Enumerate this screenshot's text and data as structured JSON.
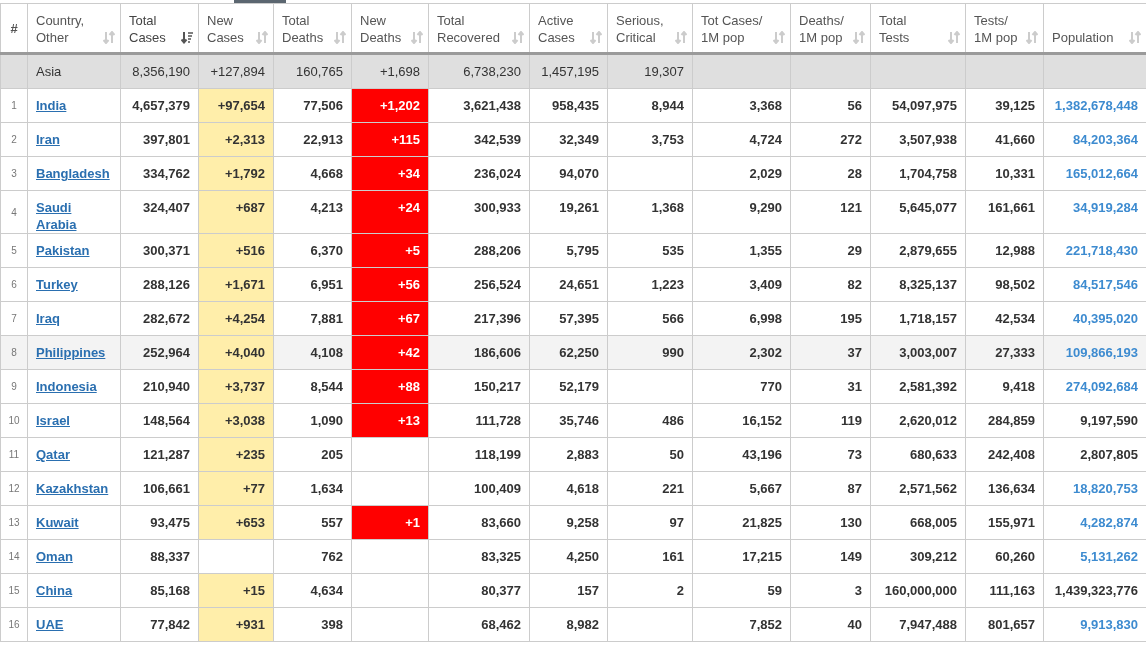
{
  "table": {
    "columns": [
      {
        "label": "#"
      },
      {
        "label": "Country,\nOther",
        "sorted": false
      },
      {
        "label": "Total\nCases",
        "sorted": true
      },
      {
        "label": "New\nCases",
        "sorted": false
      },
      {
        "label": "Total\nDeaths",
        "sorted": false
      },
      {
        "label": "New\nDeaths",
        "sorted": false
      },
      {
        "label": "Total\nRecovered",
        "sorted": false
      },
      {
        "label": "Active\nCases",
        "sorted": false
      },
      {
        "label": "Serious,\nCritical",
        "sorted": false
      },
      {
        "label": "Tot Cases/\n1M pop",
        "sorted": false
      },
      {
        "label": "Deaths/\n1M pop",
        "sorted": false
      },
      {
        "label": "Total\nTests",
        "sorted": false
      },
      {
        "label": "Tests/\n1M pop",
        "sorted": false
      },
      {
        "label": "Population",
        "sorted": false
      }
    ],
    "total_row": {
      "country": "Asia",
      "total_cases": "8,356,190",
      "new_cases": "+127,894",
      "total_deaths": "160,765",
      "new_deaths": "+1,698",
      "total_recovered": "6,738,230",
      "active_cases": "1,457,195",
      "serious_critical": "19,307"
    },
    "rows": [
      {
        "rank": "1",
        "country": "India",
        "total_cases": "4,657,379",
        "new_cases": "+97,654",
        "total_deaths": "77,506",
        "new_deaths": "+1,202",
        "total_recovered": "3,621,438",
        "active_cases": "958,435",
        "serious_critical": "8,944",
        "tot_cases_per_1m": "3,368",
        "deaths_per_1m": "56",
        "total_tests": "54,097,975",
        "tests_per_1m": "39,125",
        "population": "1,382,678,448",
        "population_link": true,
        "selected": false
      },
      {
        "rank": "2",
        "country": "Iran",
        "total_cases": "397,801",
        "new_cases": "+2,313",
        "total_deaths": "22,913",
        "new_deaths": "+115",
        "total_recovered": "342,539",
        "active_cases": "32,349",
        "serious_critical": "3,753",
        "tot_cases_per_1m": "4,724",
        "deaths_per_1m": "272",
        "total_tests": "3,507,938",
        "tests_per_1m": "41,660",
        "population": "84,203,364",
        "population_link": true,
        "selected": false
      },
      {
        "rank": "3",
        "country": "Bangladesh",
        "total_cases": "334,762",
        "new_cases": "+1,792",
        "total_deaths": "4,668",
        "new_deaths": "+34",
        "total_recovered": "236,024",
        "active_cases": "94,070",
        "tot_cases_per_1m": "2,029",
        "deaths_per_1m": "28",
        "total_tests": "1,704,758",
        "tests_per_1m": "10,331",
        "population": "165,012,664",
        "population_link": true,
        "selected": false
      },
      {
        "rank": "4",
        "country": "Saudi Arabia",
        "total_cases": "324,407",
        "new_cases": "+687",
        "total_deaths": "4,213",
        "new_deaths": "+24",
        "total_recovered": "300,933",
        "active_cases": "19,261",
        "serious_critical": "1,368",
        "tot_cases_per_1m": "9,290",
        "deaths_per_1m": "121",
        "total_tests": "5,645,077",
        "tests_per_1m": "161,661",
        "population": "34,919,284",
        "population_link": true,
        "selected": false
      },
      {
        "rank": "5",
        "country": "Pakistan",
        "total_cases": "300,371",
        "new_cases": "+516",
        "total_deaths": "6,370",
        "new_deaths": "+5",
        "total_recovered": "288,206",
        "active_cases": "5,795",
        "serious_critical": "535",
        "tot_cases_per_1m": "1,355",
        "deaths_per_1m": "29",
        "total_tests": "2,879,655",
        "tests_per_1m": "12,988",
        "population": "221,718,430",
        "population_link": true,
        "selected": false
      },
      {
        "rank": "6",
        "country": "Turkey",
        "total_cases": "288,126",
        "new_cases": "+1,671",
        "total_deaths": "6,951",
        "new_deaths": "+56",
        "total_recovered": "256,524",
        "active_cases": "24,651",
        "serious_critical": "1,223",
        "tot_cases_per_1m": "3,409",
        "deaths_per_1m": "82",
        "total_tests": "8,325,137",
        "tests_per_1m": "98,502",
        "population": "84,517,546",
        "population_link": true,
        "selected": false
      },
      {
        "rank": "7",
        "country": "Iraq",
        "total_cases": "282,672",
        "new_cases": "+4,254",
        "total_deaths": "7,881",
        "new_deaths": "+67",
        "total_recovered": "217,396",
        "active_cases": "57,395",
        "serious_critical": "566",
        "tot_cases_per_1m": "6,998",
        "deaths_per_1m": "195",
        "total_tests": "1,718,157",
        "tests_per_1m": "42,534",
        "population": "40,395,020",
        "population_link": true,
        "selected": false
      },
      {
        "rank": "8",
        "country": "Philippines",
        "total_cases": "252,964",
        "new_cases": "+4,040",
        "total_deaths": "4,108",
        "new_deaths": "+42",
        "total_recovered": "186,606",
        "active_cases": "62,250",
        "serious_critical": "990",
        "tot_cases_per_1m": "2,302",
        "deaths_per_1m": "37",
        "total_tests": "3,003,007",
        "tests_per_1m": "27,333",
        "population": "109,866,193",
        "population_link": true,
        "selected": true
      },
      {
        "rank": "9",
        "country": "Indonesia",
        "total_cases": "210,940",
        "new_cases": "+3,737",
        "total_deaths": "8,544",
        "new_deaths": "+88",
        "total_recovered": "150,217",
        "active_cases": "52,179",
        "tot_cases_per_1m": "770",
        "deaths_per_1m": "31",
        "total_tests": "2,581,392",
        "tests_per_1m": "9,418",
        "population": "274,092,684",
        "population_link": true,
        "selected": false
      },
      {
        "rank": "10",
        "country": "Israel",
        "total_cases": "148,564",
        "new_cases": "+3,038",
        "total_deaths": "1,090",
        "new_deaths": "+13",
        "total_recovered": "111,728",
        "active_cases": "35,746",
        "serious_critical": "486",
        "tot_cases_per_1m": "16,152",
        "deaths_per_1m": "119",
        "total_tests": "2,620,012",
        "tests_per_1m": "284,859",
        "population": "9,197,590",
        "population_link": false,
        "selected": false
      },
      {
        "rank": "11",
        "country": "Qatar",
        "total_cases": "121,287",
        "new_cases": "+235",
        "total_deaths": "205",
        "total_recovered": "118,199",
        "active_cases": "2,883",
        "serious_critical": "50",
        "tot_cases_per_1m": "43,196",
        "deaths_per_1m": "73",
        "total_tests": "680,633",
        "tests_per_1m": "242,408",
        "population": "2,807,805",
        "population_link": false,
        "selected": false
      },
      {
        "rank": "12",
        "country": "Kazakhstan",
        "total_cases": "106,661",
        "new_cases": "+77",
        "total_deaths": "1,634",
        "total_recovered": "100,409",
        "active_cases": "4,618",
        "serious_critical": "221",
        "tot_cases_per_1m": "5,667",
        "deaths_per_1m": "87",
        "total_tests": "2,571,562",
        "tests_per_1m": "136,634",
        "population": "18,820,753",
        "population_link": true,
        "selected": false
      },
      {
        "rank": "13",
        "country": "Kuwait",
        "total_cases": "93,475",
        "new_cases": "+653",
        "total_deaths": "557",
        "new_deaths": "+1",
        "total_recovered": "83,660",
        "active_cases": "9,258",
        "serious_critical": "97",
        "tot_cases_per_1m": "21,825",
        "deaths_per_1m": "130",
        "total_tests": "668,005",
        "tests_per_1m": "155,971",
        "population": "4,282,874",
        "population_link": true,
        "selected": false
      },
      {
        "rank": "14",
        "country": "Oman",
        "total_cases": "88,337",
        "total_deaths": "762",
        "total_recovered": "83,325",
        "active_cases": "4,250",
        "serious_critical": "161",
        "tot_cases_per_1m": "17,215",
        "deaths_per_1m": "149",
        "total_tests": "309,212",
        "tests_per_1m": "60,260",
        "population": "5,131,262",
        "population_link": true,
        "selected": false
      },
      {
        "rank": "15",
        "country": "China",
        "total_cases": "85,168",
        "new_cases": "+15",
        "total_deaths": "4,634",
        "total_recovered": "80,377",
        "active_cases": "157",
        "serious_critical": "2",
        "tot_cases_per_1m": "59",
        "deaths_per_1m": "3",
        "total_tests": "160,000,000",
        "tests_per_1m": "111,163",
        "population": "1,439,323,776",
        "population_link": false,
        "selected": false
      },
      {
        "rank": "16",
        "country": "UAE",
        "total_cases": "77,842",
        "new_cases": "+931",
        "total_deaths": "398",
        "total_recovered": "68,462",
        "active_cases": "8,982",
        "tot_cases_per_1m": "7,852",
        "deaths_per_1m": "40",
        "total_tests": "7,947,488",
        "tests_per_1m": "801,657",
        "population": "9,913,830",
        "population_link": true,
        "selected": false
      }
    ]
  }
}
